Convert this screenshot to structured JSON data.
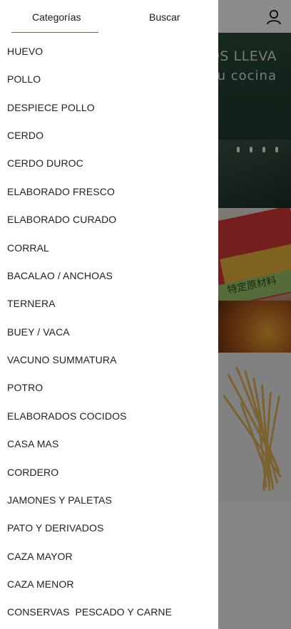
{
  "header": {
    "icons": [
      "user-icon"
    ]
  },
  "drawer": {
    "tabs": [
      {
        "label": "Categorías",
        "active": true
      },
      {
        "label": "Buscar",
        "active": false
      }
    ],
    "indicator_color": "#b8404f",
    "categories": [
      "HUEVO",
      "POLLO",
      "DESPIECE POLLO",
      "CERDO",
      "CERDO DUROC",
      "ELABORADO FRESCO",
      "ELABORADO CURADO",
      "CORRAL",
      "BACALAO / ANCHOAS",
      "TERNERA",
      "BUEY / VACA",
      "VACUNO SUMMATURA",
      "POTRO",
      "ELABORADOS COCIDOS",
      "CASA MAS",
      "CORDERO",
      "JAMONES Y PALETAS",
      "PATO Y DERIVADOS",
      "CAZA MAYOR",
      "CAZA MENOR",
      "CONSERVAS  PESCADO Y CARNE"
    ]
  },
  "banners": [
    {
      "line1": "IOS LLEVA",
      "line2": "u cocina"
    },
    {
      "text": "特定原材料"
    },
    {}
  ]
}
